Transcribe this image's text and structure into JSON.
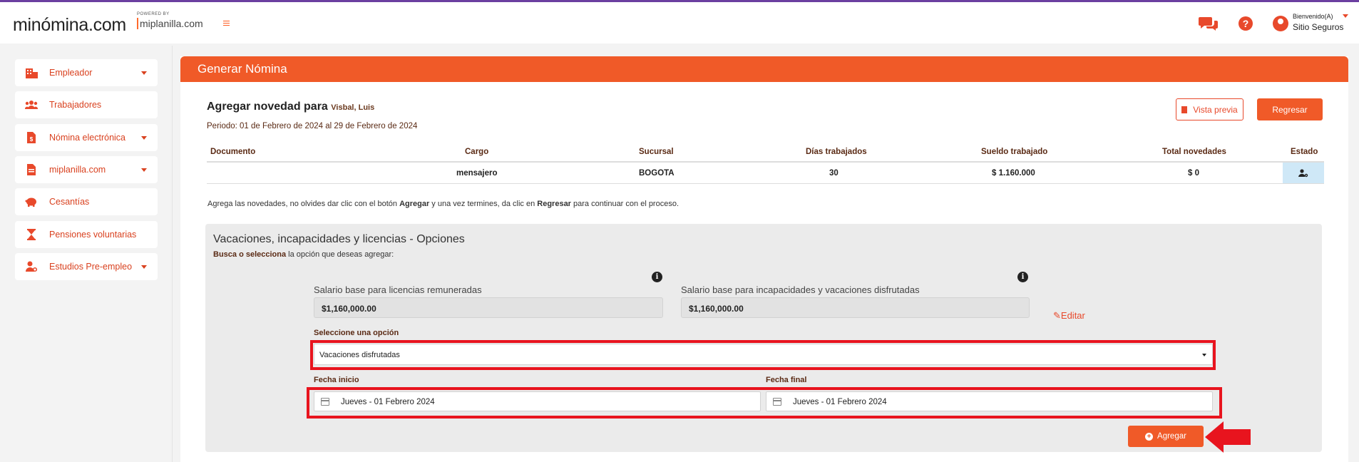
{
  "header": {
    "logo": "minómina.com",
    "powered_by": "POWERED BY",
    "partner": "miplanilla.com",
    "user_greeting": "Bienvenido(A)",
    "user_name": "Sitio Seguros"
  },
  "sidebar": {
    "items": [
      {
        "label": "Empleador",
        "icon": "building-icon",
        "has_submenu": true
      },
      {
        "label": "Trabajadores",
        "icon": "users-icon",
        "has_submenu": false
      },
      {
        "label": "Nómina electrónica",
        "icon": "invoice-icon",
        "has_submenu": true
      },
      {
        "label": "miplanilla.com",
        "icon": "document-icon",
        "has_submenu": true
      },
      {
        "label": "Cesantías",
        "icon": "piggy-bank-icon",
        "has_submenu": false
      },
      {
        "label": "Pensiones voluntarias",
        "icon": "hourglass-icon",
        "has_submenu": false
      },
      {
        "label": "Estudios Pre-empleo",
        "icon": "user-search-icon",
        "has_submenu": true
      }
    ]
  },
  "page": {
    "title": "Generar Nómina",
    "novedad_prefix": "Agregar novedad para",
    "employee": "Visbal, Luis",
    "periodo": "Periodo: 01 de Febrero de 2024 al 29 de Febrero de 2024",
    "preview_button": "Vista previa",
    "back_button": "Regresar"
  },
  "table": {
    "headers": [
      "Documento",
      "Cargo",
      "Sucursal",
      "Días trabajados",
      "Sueldo trabajado",
      "Total novedades",
      "Estado"
    ],
    "row": {
      "documento": "",
      "cargo": "mensajero",
      "sucursal": "BOGOTA",
      "dias": "30",
      "sueldo": "$ 1.160.000",
      "total": "$ 0"
    }
  },
  "help": {
    "part1": "Agrega las novedades, no olvides dar clic con el botón ",
    "agregar": "Agregar",
    "part2": " y una vez termines, da clic en ",
    "regresar": "Regresar",
    "part3": " para continuar con el proceso."
  },
  "panel": {
    "title": "Vacaciones, incapacidades y licencias - Opciones",
    "sub_bold": "Busca o selecciona",
    "sub_rest": " la opción que deseas agregar:",
    "salary_lic_label": "Salario base para licencias remuneradas",
    "salary_lic_value": "$1,160,000.00",
    "salary_inc_label": "Salario base para incapacidades y vacaciones disfrutadas",
    "salary_inc_value": "$1,160,000.00",
    "edit_label": "Editar",
    "select_label": "Seleccione una opción",
    "select_value": "Vacaciones disfrutadas",
    "fecha_inicio_label": "Fecha inicio",
    "fecha_inicio_value": "Jueves - 01 Febrero 2024",
    "fecha_final_label": "Fecha final",
    "fecha_final_value": "Jueves - 01 Febrero 2024",
    "add_button": "Agregar"
  },
  "colors": {
    "accent": "#f05a28",
    "highlight": "#e8141e",
    "estado_bg": "#cfe8f7"
  }
}
